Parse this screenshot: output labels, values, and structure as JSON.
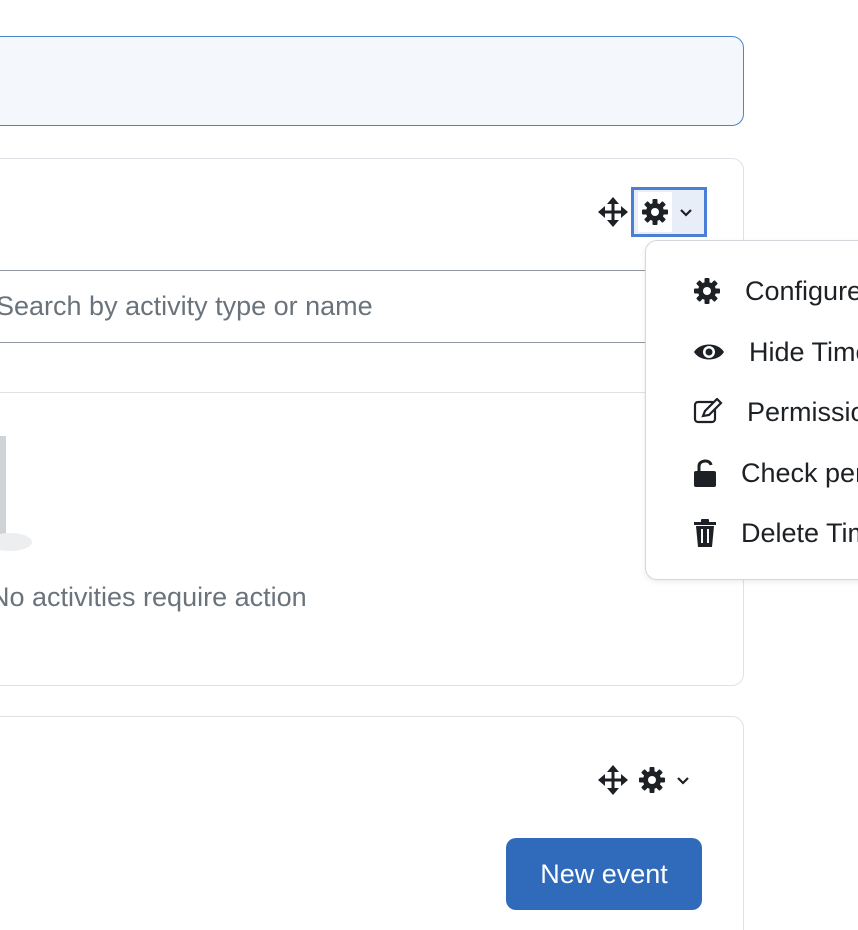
{
  "search": {
    "placeholder": "Search by activity type or name"
  },
  "timeline": {
    "empty_text": "No activities require action",
    "controls": {
      "move": "move-icon",
      "actions": "gear-icon",
      "toggle": "chevron-down-icon"
    }
  },
  "calendar": {
    "new_event_label": "New event",
    "controls": {
      "move": "move-icon",
      "actions": "gear-icon",
      "toggle": "chevron-down-icon"
    }
  },
  "block_menu": {
    "items": [
      {
        "label": "Configure Timeline block",
        "icon": "gear-icon"
      },
      {
        "label": "Hide Timeline block",
        "icon": "eye-icon"
      },
      {
        "label": "Permissions in Timeline block",
        "icon": "edit-icon"
      },
      {
        "label": "Check permissions in Timeline block",
        "icon": "unlock-icon"
      },
      {
        "label": "Delete Timeline block",
        "icon": "trash-icon"
      }
    ]
  },
  "colors": {
    "accent": "#2f6bba",
    "focus": "#4b7fd6",
    "border": "#dee2e6",
    "muted_text": "#6a737b",
    "banner_bg": "#f4f7fb"
  }
}
